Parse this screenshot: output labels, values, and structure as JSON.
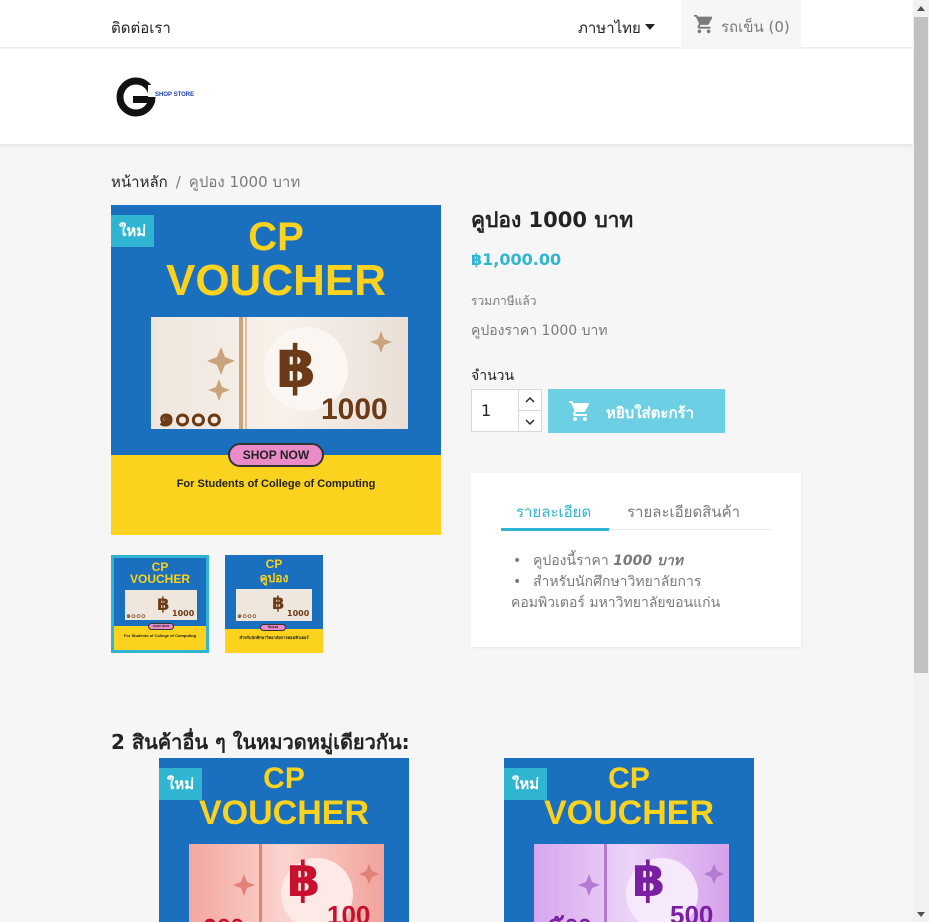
{
  "topbar": {
    "contact": "ติดต่อเรา",
    "language": "ภาษาไทย",
    "cart": "รถเข็น (0)"
  },
  "logo": {
    "text": "SHOP STORE"
  },
  "breadcrumb": {
    "home": "หน้าหลัก",
    "separator": "/",
    "current": "คูปอง 1000 บาท"
  },
  "product": {
    "badge": "ใหม่",
    "title": "คูปอง 1000 บาท",
    "price": "฿1,000.00",
    "tax_note": "รวมภาษีแล้ว",
    "short_desc": "คูปองราคา 1000 บาท",
    "qty_label": "จำนวน",
    "qty_value": "1",
    "add_to_cart": "หยิบใส่ตะกร้า",
    "image": {
      "title_line1": "CP",
      "title_line2": "VOUCHER",
      "thai_number": "๑๐๐๐",
      "number": "1000",
      "currency": "฿",
      "shop_now": "SHOP NOW",
      "footer": "For Students of College of Computing"
    },
    "thumbnails": [
      {
        "title_line1": "CP",
        "title_line2": "VOUCHER",
        "thai_number": "๑๐๐๐",
        "number": "1000",
        "shop": "SHOP NOW",
        "footer": "For Students of College of Computing"
      },
      {
        "title_line1": "CP",
        "title_line2": "คูปอง",
        "thai_number": "๑๐๐๐",
        "number": "1000",
        "shop": "ช้อปเลย",
        "footer": "สำหรับนักศึกษาวิทยาลัยการคอมพิวเตอร์"
      }
    ]
  },
  "tabs": {
    "description": "รายละเอียด",
    "details": "รายละเอียดสินค้า",
    "bullet1_prefix": "คูปองนี้ราคา ",
    "bullet1_em": "1000 บาท",
    "bullet2_line1": "สำหรับนักศึกษาวิทยาลัยการ",
    "bullet2_line2": "คอมพิวเตอร์ มหาวิทยาลัยขอนแก่น"
  },
  "related": {
    "title": "2 สินค้าอื่น ๆ ในหมวดหมู่เดียวกัน:",
    "items": [
      {
        "badge": "ใหม่",
        "title_line1": "CP",
        "title_line2": "VOUCHER",
        "thai_number": "๑๐๐",
        "number": "100",
        "currency": "฿",
        "color": "#c8102e"
      },
      {
        "badge": "ใหม่",
        "title_line1": "CP",
        "title_line2": "VOUCHER",
        "thai_number": "๕๐๐",
        "number": "500",
        "currency": "฿",
        "color": "#7b1fa2"
      }
    ]
  },
  "colors": {
    "accent": "#2fb5d2",
    "button": "#6ccfe4",
    "voucher_blue": "#1a6fbf",
    "voucher_yellow": "#fbd21d"
  }
}
